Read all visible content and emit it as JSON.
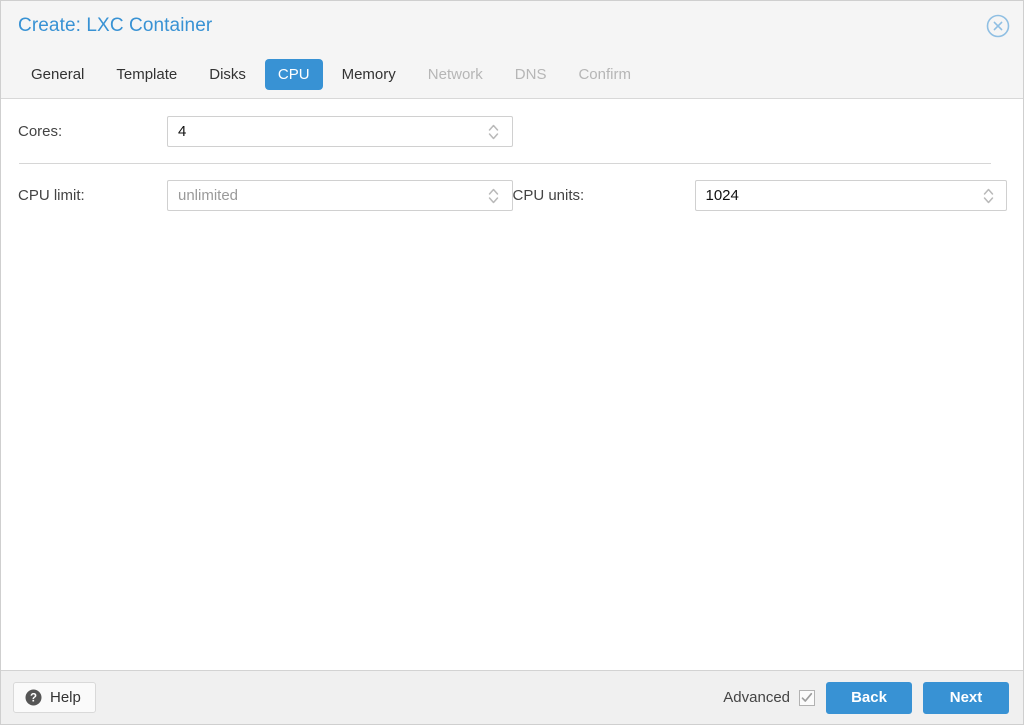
{
  "window": {
    "title": "Create: LXC Container",
    "close_icon": "close-circle-icon",
    "accent_color": "#3892d4",
    "title_color": "#3892d4"
  },
  "tabs": [
    {
      "label": "General",
      "state": "enabled"
    },
    {
      "label": "Template",
      "state": "enabled"
    },
    {
      "label": "Disks",
      "state": "enabled"
    },
    {
      "label": "CPU",
      "state": "active"
    },
    {
      "label": "Memory",
      "state": "enabled"
    },
    {
      "label": "Network",
      "state": "disabled"
    },
    {
      "label": "DNS",
      "state": "disabled"
    },
    {
      "label": "Confirm",
      "state": "disabled"
    }
  ],
  "form": {
    "cores": {
      "label": "Cores:",
      "value": "4",
      "placeholder": "",
      "spinner_icon": "spinner-arrows-icon"
    },
    "cpu_limit": {
      "label": "CPU limit:",
      "value": "",
      "placeholder": "unlimited",
      "display": "unlimited",
      "spinner_icon": "spinner-arrows-icon"
    },
    "cpu_units": {
      "label": "CPU units:",
      "value": "1024",
      "placeholder": "",
      "spinner_icon": "spinner-arrows-icon"
    }
  },
  "footer": {
    "help_label": "Help",
    "help_icon": "question-mark-circle-icon",
    "advanced_label": "Advanced",
    "advanced_checked": true,
    "check_icon": "checkmark-icon",
    "back_label": "Back",
    "next_label": "Next"
  }
}
